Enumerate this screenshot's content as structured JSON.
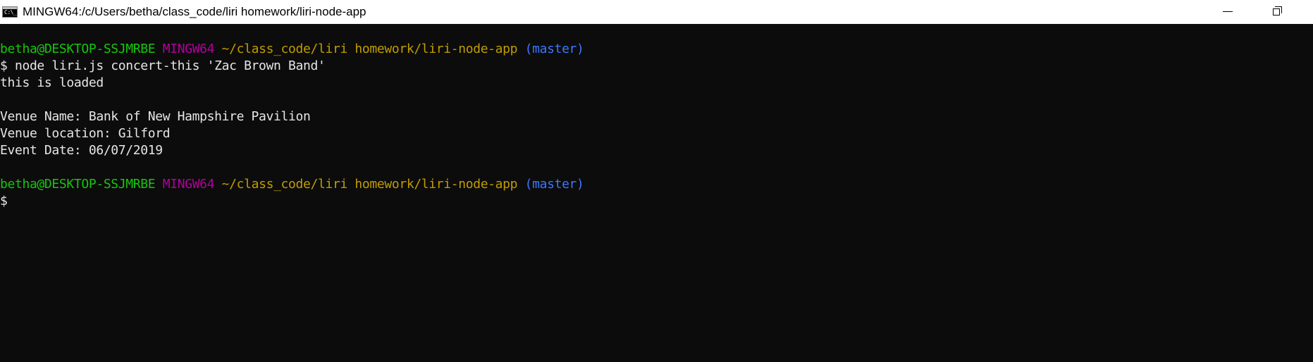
{
  "window": {
    "title": "MINGW64:/c/Users/betha/class_code/liri homework/liri-node-app",
    "icon": "console-icon",
    "icon_text": "C:\\_"
  },
  "terminal": {
    "prompt1": {
      "user_host": "betha@DESKTOP-SSJMRBE",
      "system": "MINGW64",
      "path": "~/class_code/liri homework/liri-node-app",
      "branch": "(master)"
    },
    "command_line": "$ node liri.js concert-this 'Zac Brown Band'",
    "output": [
      "this is loaded",
      "",
      "Venue Name: Bank of New Hampshire Pavilion",
      "Venue location: Gilford",
      "Event Date: 06/07/2019",
      ""
    ],
    "prompt2": {
      "user_host": "betha@DESKTOP-SSJMRBE",
      "system": "MINGW64",
      "path": "~/class_code/liri homework/liri-node-app",
      "branch": "(master)"
    },
    "cursor_line": "$"
  },
  "colors": {
    "background": "#0c0c0c",
    "text": "#e6e6e6",
    "user_host": "#16c60c",
    "system": "#b4009e",
    "path": "#c19c00",
    "branch": "#3b78ff"
  }
}
